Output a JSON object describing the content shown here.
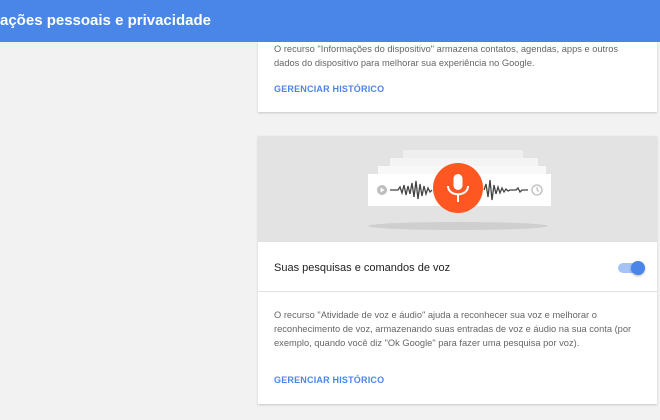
{
  "header": {
    "title": "ações pessoais e privacidade",
    "background_color": "#4a86e8"
  },
  "device_info_card": {
    "description": "O recurso \"Informações do dispositivo\" armazena contatos, agendas, apps e outros dados do dispositivo para melhorar sua experiência no Google.",
    "manage_link": "GERENCIAR HISTÓRICO"
  },
  "voice_card": {
    "illustration": {
      "icons": [
        "play-icon",
        "microphone-icon",
        "clock-icon"
      ],
      "mic_color": "#ff5722"
    },
    "setting_label": "Suas pesquisas e comandos de voz",
    "toggle": {
      "state": "on",
      "color": "#4a86e8"
    },
    "description": "O recurso \"Atividade de voz e áudio\" ajuda a reconhecer sua voz e melhorar o reconhecimento de voz, armazenando suas entradas de voz e áudio na sua conta (por exemplo, quando você diz \"Ok Google\" para fazer uma pesquisa por voz).",
    "manage_link": "GERENCIAR HISTÓRICO"
  }
}
